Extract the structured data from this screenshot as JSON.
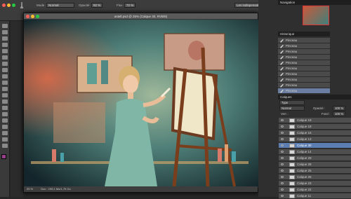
{
  "options": {
    "mode_label": "Mode :",
    "mode_value": "Normal",
    "opacity_label": "Opacité :",
    "opacity_value": "92 %",
    "flow_label": "Flux :",
    "flow_value": "72 %",
    "workspace": "Les indispensables"
  },
  "document": {
    "title": "astell.psd @ 25% (Calque 30, RVB/8)",
    "zoom": "25 %",
    "doc_size": "Doc : 199,1 Mo/1,75 Go"
  },
  "panels": {
    "navigator": "Navigation",
    "history": "Historique",
    "layers": "Calques",
    "kind": "Type",
    "blend": "Normal",
    "opacity_label": "Opacité :",
    "opacity_value": "100 %",
    "lock_label": "Verr. :",
    "fill_label": "Fond :",
    "fill_value": "100 %"
  },
  "history": [
    {
      "label": "Pinceau"
    },
    {
      "label": "Pinceau"
    },
    {
      "label": "Pinceau"
    },
    {
      "label": "Pinceau"
    },
    {
      "label": "Pinceau"
    },
    {
      "label": "Pinceau"
    },
    {
      "label": "Pinceau"
    },
    {
      "label": "Pinceau"
    },
    {
      "label": "Pinceau"
    },
    {
      "label": "Pinceau"
    }
  ],
  "layers": [
    {
      "label": "Calque 19"
    },
    {
      "label": "Calque 18"
    },
    {
      "label": "Calque 16"
    },
    {
      "label": "Calque 13"
    },
    {
      "label": "Calque 30"
    },
    {
      "label": "Calque 14"
    },
    {
      "label": "Calque 29"
    },
    {
      "label": "Calque 28"
    },
    {
      "label": "Calque 25"
    },
    {
      "label": "Calque 26"
    },
    {
      "label": "Calque 23"
    },
    {
      "label": "Calque 22"
    },
    {
      "label": "Calque 11"
    }
  ]
}
